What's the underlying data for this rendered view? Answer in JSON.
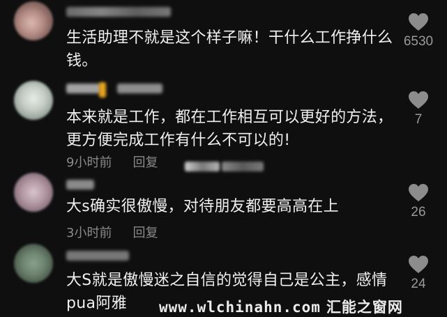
{
  "colors": {
    "background": "#0f0f10",
    "text": "#f0f0f0",
    "meta": "#8a8a8a",
    "like_icon": "#8c8c8c"
  },
  "comments": [
    {
      "text": "生活助理不就是这个样子嘛！干什么工作挣什么钱。",
      "likes": "6530",
      "like_icon": "heart-icon"
    },
    {
      "text": "本来就是工作，都在工作相互可以更好的方法，更方便完成工作有什么不可以的!",
      "time": "9小时前",
      "reply": "回复",
      "likes": "7",
      "like_icon": "heart-icon"
    },
    {
      "text": "大s确实很傲慢，对待朋友都要高高在上",
      "time": "3小时前",
      "reply": "回复",
      "likes": "26",
      "like_icon": "heart-icon"
    },
    {
      "text": "大S就是傲慢迷之自信的觉得自己是公主，感情pua阿雅",
      "likes": "24",
      "like_icon": "heart-icon"
    }
  ],
  "watermark": {
    "url": "www.wlchinahn.com",
    "brand": "汇能之窗网"
  }
}
